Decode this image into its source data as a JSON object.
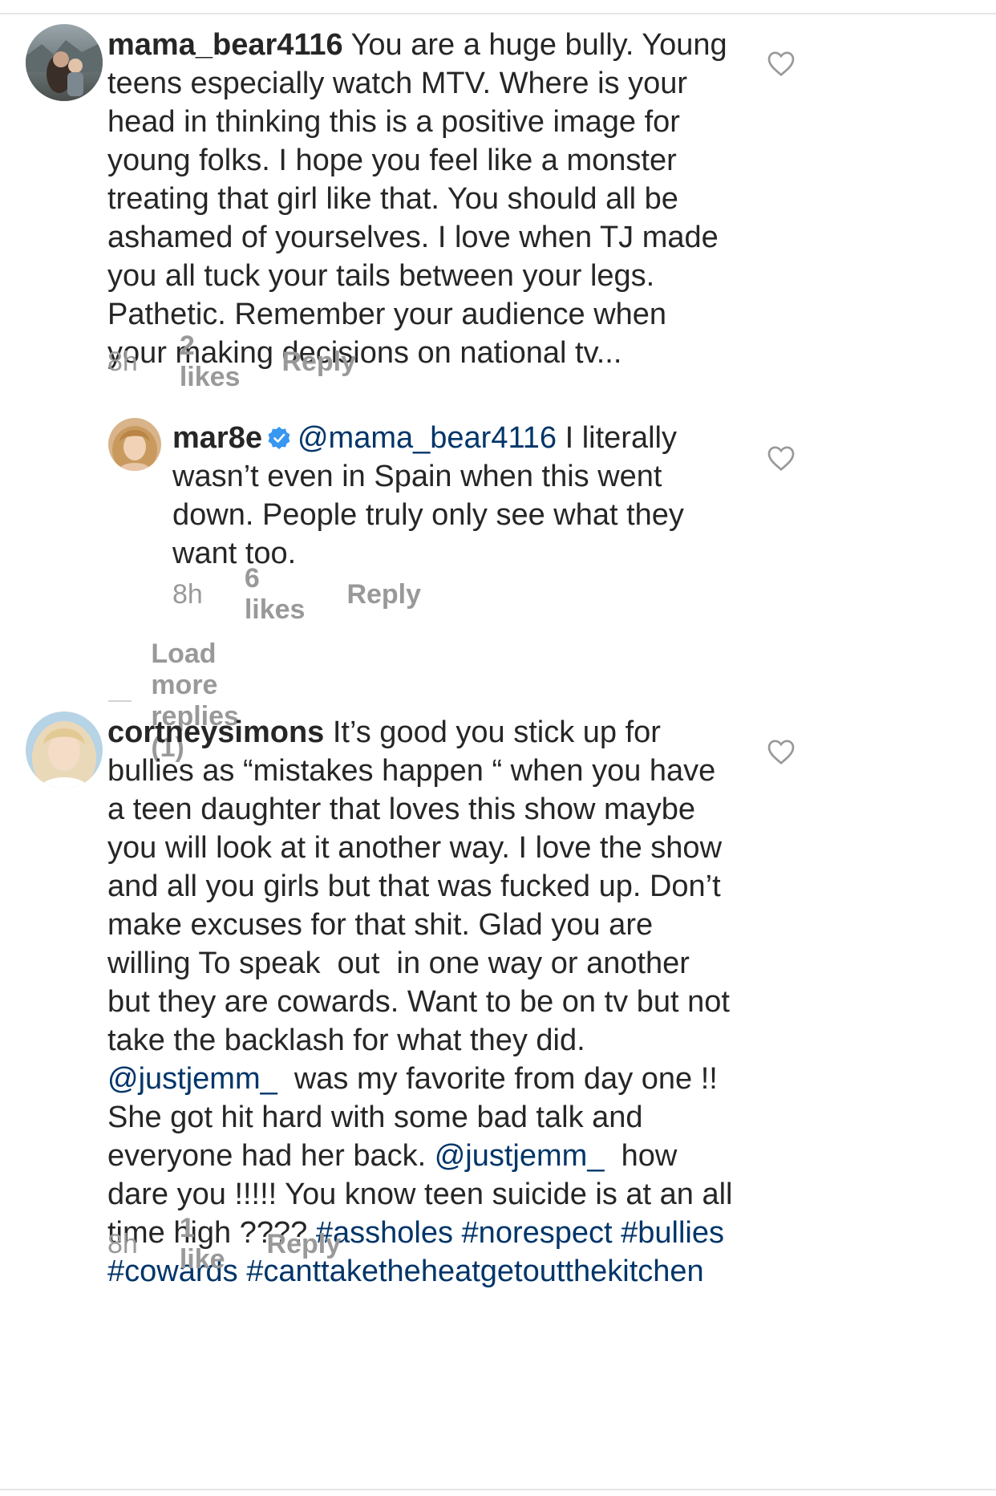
{
  "comments": [
    {
      "username": "mama_bear4116",
      "text": "You are a huge bully. Young teens especially watch MTV. Where is your head in thinking this is a positive image for young folks. I hope you feel like a monster treating that girl like that. You should all be ashamed of yourselves. I love when TJ made you all tuck your tails between your legs. Pathetic. Remember your audience when your making decisions on national tv...",
      "time": "8h",
      "likes": "2 likes",
      "reply_label": "Reply"
    },
    {
      "username": "mar8e",
      "verified": true,
      "mention": "@mama_bear4116",
      "text": "I literally wasn’t even in Spain when this went down. People truly only see what they want too.",
      "time": "8h",
      "likes": "6 likes",
      "reply_label": "Reply",
      "load_more": "Load more replies (1)"
    },
    {
      "username": "cortneysimons",
      "text_1": "It’s good you stick up for bullies as “mistakes happen “ when you have a teen daughter that loves this show maybe you will look at it another way. I love the show and all you girls but that was fucked up. Don’t make excuses for that shit. Glad you are willing To speak  out  in one way or another but they are cowards. Want to be on tv but not take the backlash for what they did. ",
      "mention_1": "@justjemm_",
      "text_2": "  was my favorite from day one !! She got hit hard with some bad talk and everyone had her back.",
      "mention_2": "@justjemm_",
      "text_3": "  how dare you !!!!! You know teen suicide is at an all time high ????",
      "hashtag_1": "#assholes",
      "hashtag_2": "#norespect",
      "hashtag_3": "#bullies",
      "hashtag_4": "#cowards",
      "hashtag_5": "#canttaketheheatgetoutthekitchen",
      "time": "8h",
      "likes": "1 like",
      "reply_label": "Reply"
    }
  ],
  "icons": {
    "like": "heart-outline-icon",
    "verified": "verified-badge-icon"
  },
  "colors": {
    "link": "#003569",
    "meta": "#999999",
    "text": "#262626",
    "verified": "#3897f0"
  }
}
